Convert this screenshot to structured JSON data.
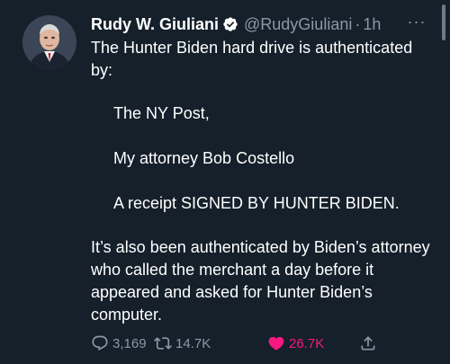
{
  "tweet": {
    "display_name": "Rudy W. Giuliani",
    "handle": "@RudyGiuliani",
    "separator": "·",
    "time": "1h",
    "more_label": "···",
    "text": {
      "intro": "The Hunter Biden hard drive is authenticated by:",
      "list": [
        "The NY Post,",
        "My attorney Bob Costello",
        "A receipt SIGNED BY HUNTER BIDEN."
      ],
      "closing": "It’s also been authenticated by Biden’s attorney who called the merchant a day before it appeared and asked for Hunter Biden’s computer."
    },
    "actions": {
      "reply_count": "3,169",
      "retweet_count": "14.7K",
      "like_count": "26.7K"
    }
  },
  "icons": {
    "verified": "verified-badge-icon",
    "reply": "speech-bubble-icon",
    "retweet": "retweet-arrows-icon",
    "like": "heart-icon",
    "share": "share-upload-icon",
    "more": "ellipsis-icon"
  },
  "colors": {
    "background": "#15202b",
    "text": "#ffffff",
    "secondary_text": "#8b98a5",
    "like_active": "#f91880",
    "verified_badge": "#ffffff"
  }
}
